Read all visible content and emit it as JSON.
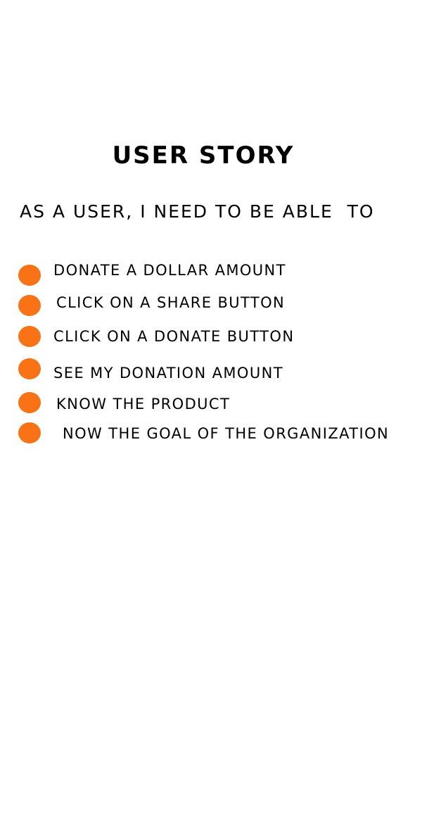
{
  "page": {
    "title": "USER STORY",
    "subtitle": "AS A USER, I NEED TO BE ABLE  TO"
  },
  "stories": [
    {
      "label": "DONATE A DOLLAR AMOUNT"
    },
    {
      "label": "CLICK ON A SHARE BUTTON"
    },
    {
      "label": "CLICK ON A DONATE BUTTON"
    },
    {
      "label": "SEE MY DONATION AMOUNT"
    },
    {
      "label": "KNOW THE PRODUCT"
    },
    {
      "label": "NOW THE GOAL OF THE ORGANIZATION"
    }
  ],
  "colors": {
    "bullet": "#f97316",
    "background": "#ffffff",
    "text": "#000000"
  },
  "icons": {
    "bullet": "orange-circle-bullet-icon"
  }
}
